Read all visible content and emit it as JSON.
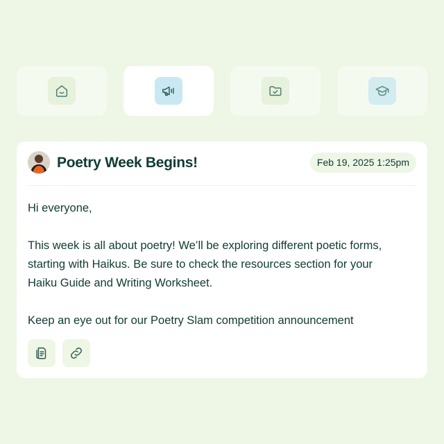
{
  "tabs": [
    {
      "icon": "home-smile-icon",
      "active": false
    },
    {
      "icon": "megaphone-icon",
      "active": true
    },
    {
      "icon": "folder-check-icon",
      "active": false
    },
    {
      "icon": "graduation-cap-icon",
      "active": false
    }
  ],
  "post": {
    "title": "Poetry Week Begins!",
    "date": "Feb 19, 2025 1:25pm",
    "body": [
      "Hi everyone,",
      "This week is all about poetry! We’ll be exploring different poetic forms,",
      "starting with Haikus. Be sure to check the resources section for your",
      "Haiku Guide and Writing Worksheet.",
      "Keep an eye out for our Poetry Slam competition announcement"
    ],
    "attachments": [
      {
        "icon": "document-icon"
      },
      {
        "icon": "link-icon"
      }
    ]
  },
  "colors": {
    "background": "#eef6e6",
    "text": "#0f3b33",
    "active_tab_icon_bg": "#c9e8f3",
    "avatar_accent": "#e8641e"
  }
}
